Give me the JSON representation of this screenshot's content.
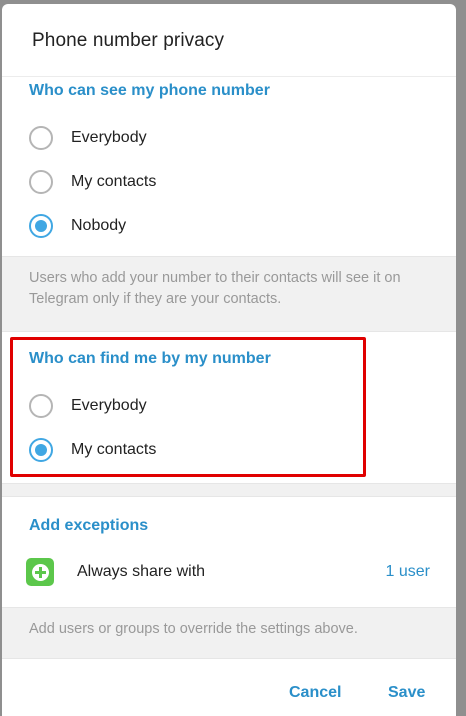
{
  "dialog": {
    "title": "Phone number privacy"
  },
  "see_section": {
    "header": "Who can see my phone number",
    "options": [
      {
        "label": "Everybody",
        "checked": false
      },
      {
        "label": "My contacts",
        "checked": false
      },
      {
        "label": "Nobody",
        "checked": true
      }
    ],
    "note": "Users who add your number to their contacts will see it on Telegram only if they are your contacts."
  },
  "find_section": {
    "header": "Who can find me by my number",
    "options": [
      {
        "label": "Everybody",
        "checked": false
      },
      {
        "label": "My contacts",
        "checked": true
      }
    ]
  },
  "exceptions": {
    "header": "Add exceptions",
    "row_label": "Always share with",
    "row_count": "1 user",
    "note": "Add users or groups to override the settings above."
  },
  "buttons": {
    "cancel": "Cancel",
    "save": "Save"
  },
  "colors": {
    "accent": "#2a8fc9",
    "radio_checked": "#40a7e3",
    "highlight": "#e00000",
    "add_icon": "#5cc74b"
  }
}
